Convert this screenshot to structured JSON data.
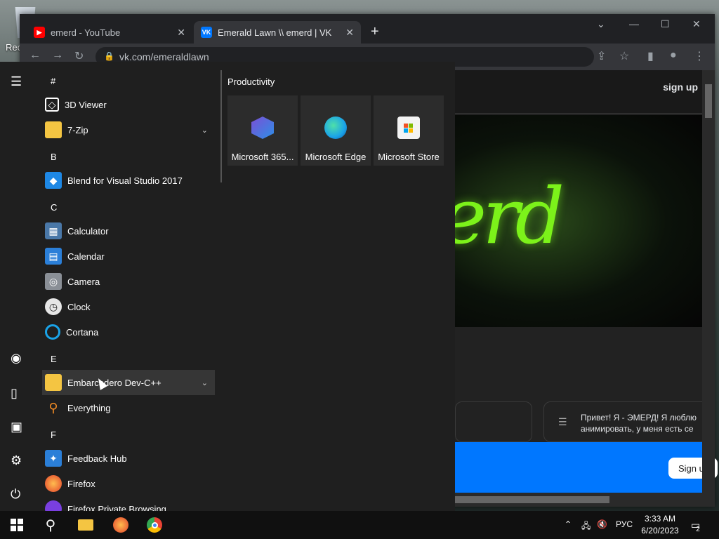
{
  "desktop": {
    "recycle_label": "Rec"
  },
  "browser": {
    "tabs": [
      {
        "title": "emerd - YouTube",
        "favicon": "youtube-icon"
      },
      {
        "title": "Emerald Lawn \\\\ emerd | VK",
        "favicon": "vk-icon",
        "active": true
      }
    ],
    "url": "vk.com/emeraldlawn",
    "page": {
      "signup": "sign up",
      "logo_text": "erd",
      "post_text_line1": "Привет! Я - ЭМЕРД! Я люблю",
      "post_text_line2": "анимировать, у меня есть се",
      "signin_button": "Sign u"
    }
  },
  "start_menu": {
    "group_title": "Productivity",
    "tiles": [
      {
        "label": "Microsoft 365...",
        "icon": "microsoft-365-icon",
        "color": "#7b4fd6"
      },
      {
        "label": "Microsoft Edge",
        "icon": "edge-icon",
        "color": "#1aa3e8"
      },
      {
        "label": "Microsoft Store",
        "icon": "store-icon",
        "color": "#f3f3f3"
      }
    ],
    "letters": [
      "#",
      "B",
      "C",
      "E",
      "F"
    ],
    "apps": [
      {
        "label": "3D Viewer",
        "icon": "cube-icon"
      },
      {
        "label": "7-Zip",
        "icon": "folder-icon",
        "expandable": true
      },
      {
        "label": "Blend for Visual Studio 2017",
        "icon": "blend-icon"
      },
      {
        "label": "Calculator",
        "icon": "calculator-icon"
      },
      {
        "label": "Calendar",
        "icon": "calendar-icon"
      },
      {
        "label": "Camera",
        "icon": "camera-icon"
      },
      {
        "label": "Clock",
        "icon": "clock-icon"
      },
      {
        "label": "Cortana",
        "icon": "cortana-icon"
      },
      {
        "label": "Embarcadero Dev-C++",
        "icon": "folder-icon",
        "expandable": true,
        "highlighted": true
      },
      {
        "label": "Everything",
        "icon": "magnifier-icon"
      },
      {
        "label": "Feedback Hub",
        "icon": "feedback-icon"
      },
      {
        "label": "Firefox",
        "icon": "firefox-icon"
      },
      {
        "label": "Firefox Private Browsing",
        "icon": "firefox-private-icon"
      }
    ]
  },
  "taskbar": {
    "language": "РУС",
    "time": "3:33 AM",
    "date": "6/20/2023",
    "notification_count": "2"
  }
}
